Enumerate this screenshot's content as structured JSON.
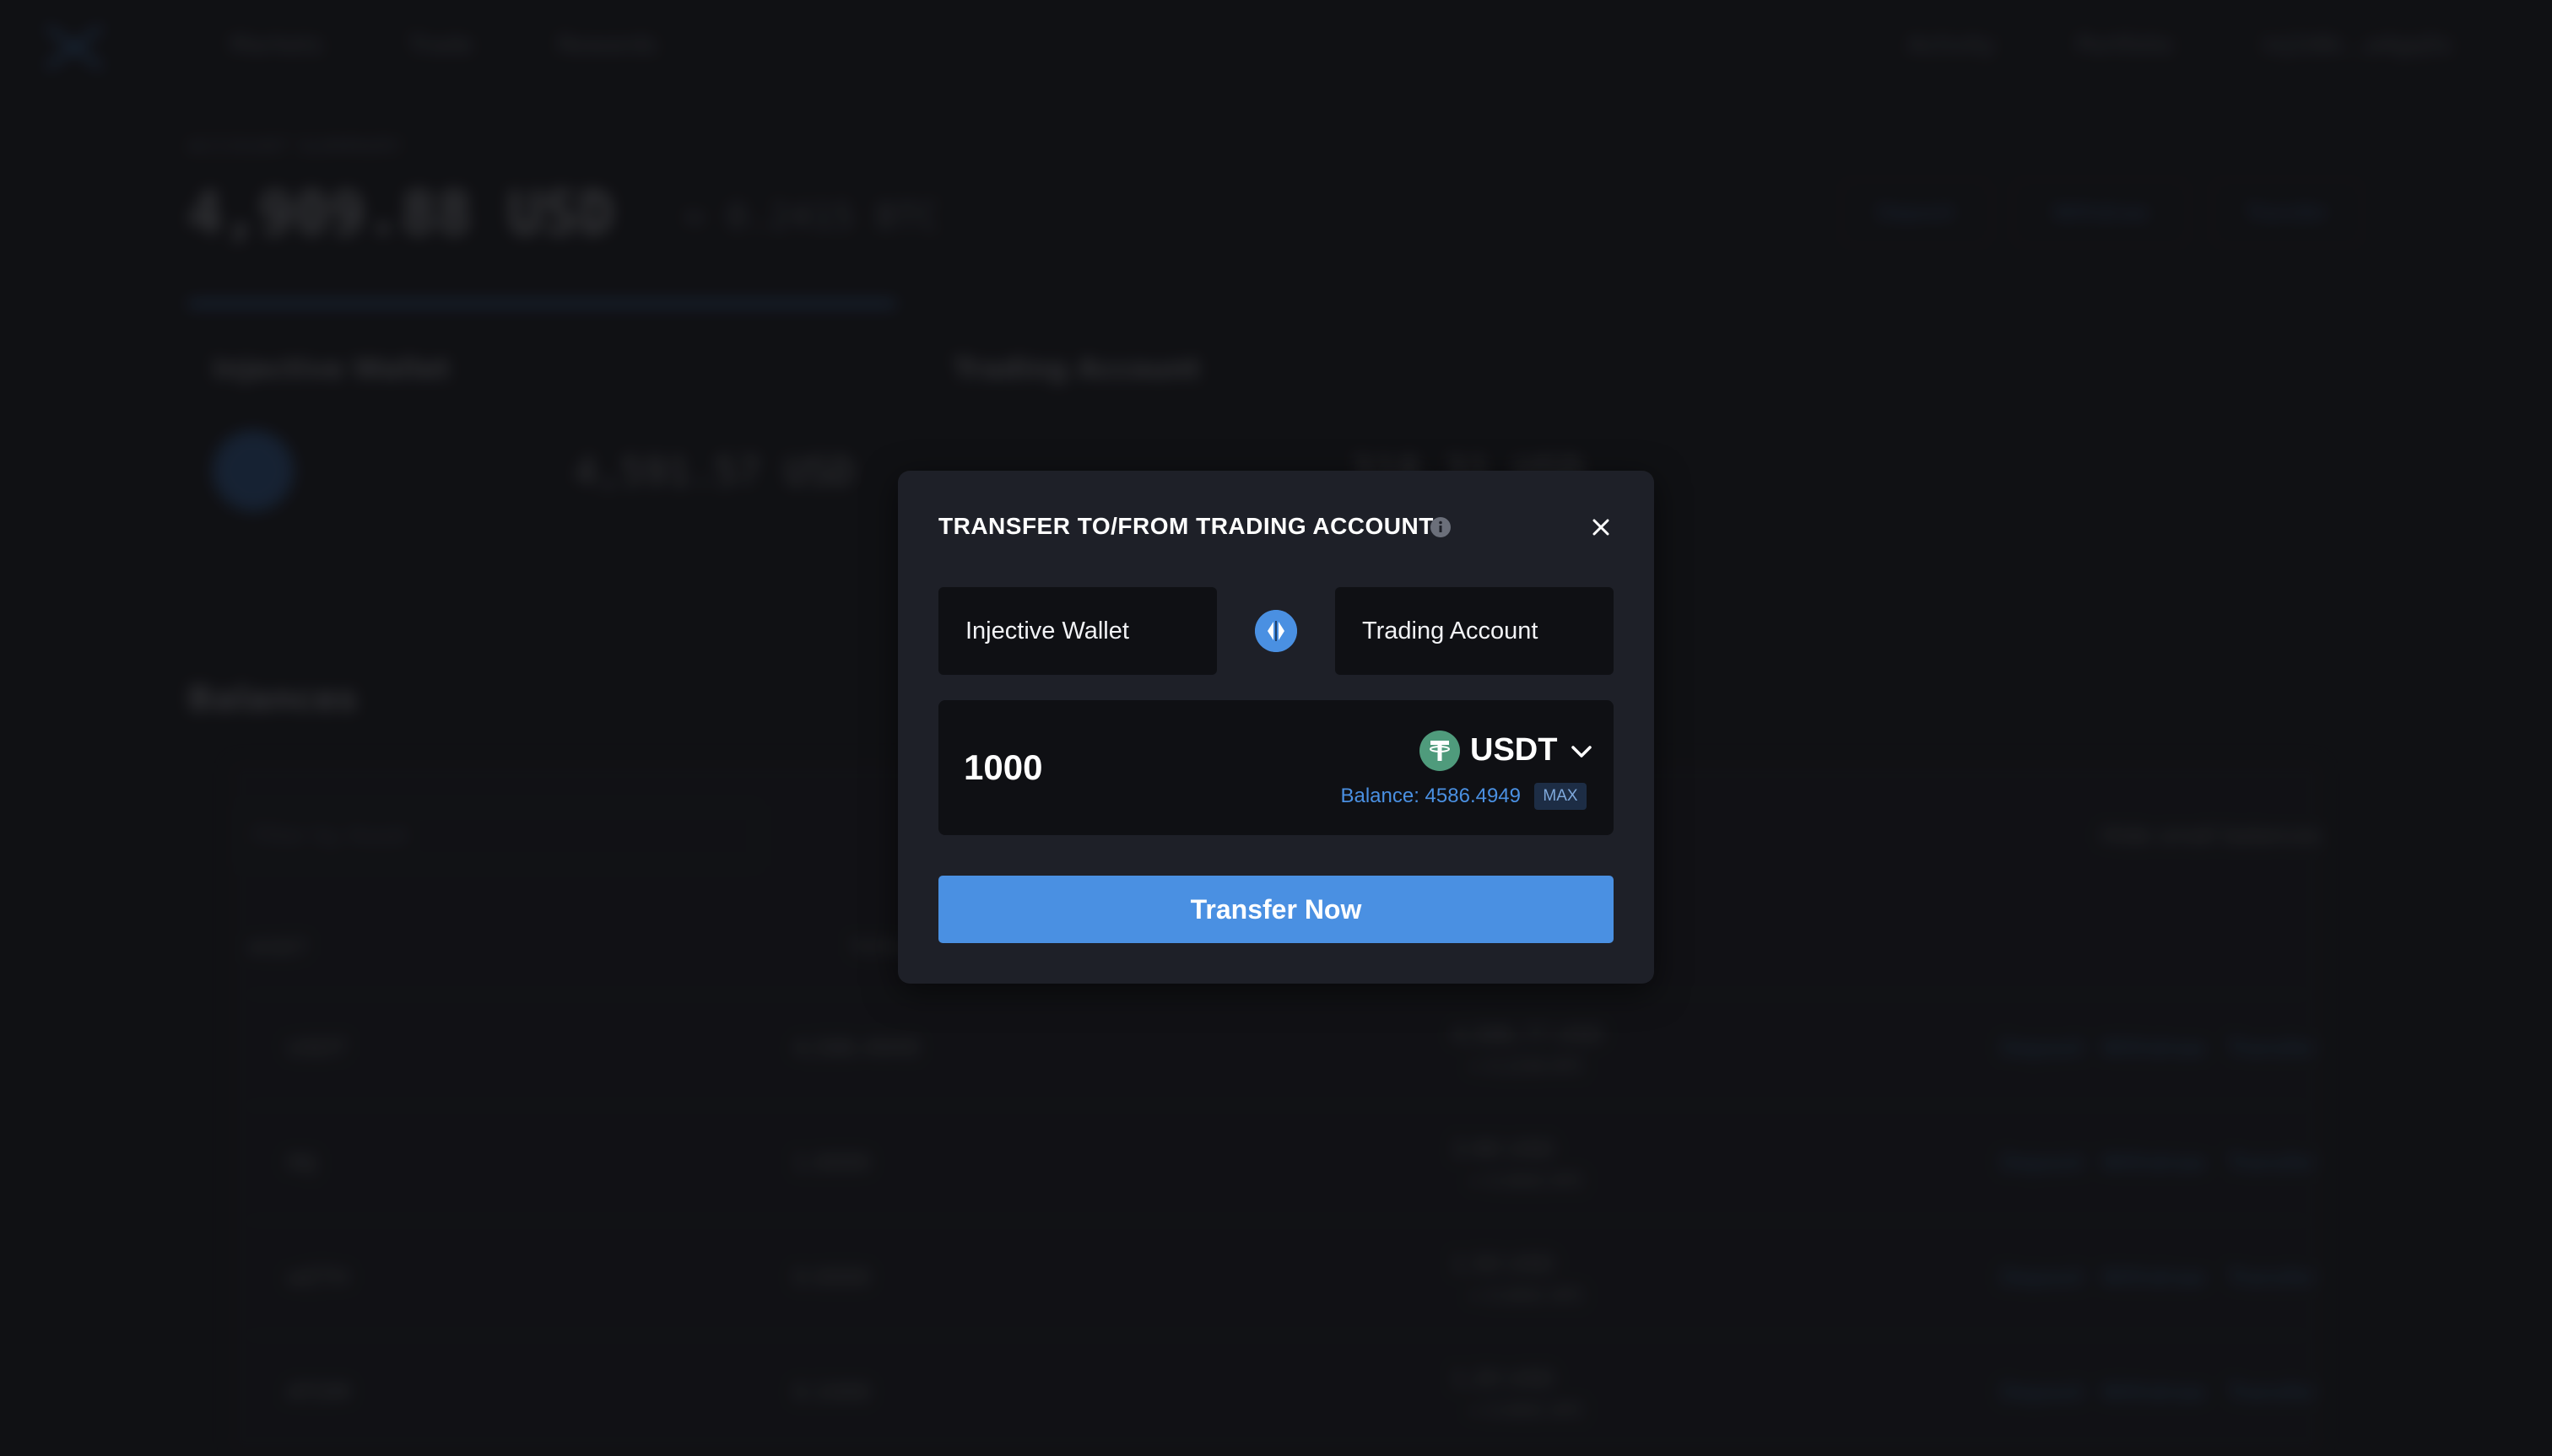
{
  "background": {
    "nav": [
      "Markets",
      "Trade",
      "Rewards"
    ],
    "nav_right": [
      "Activity",
      "Portfolio",
      "inj1t6k...a4gq5s"
    ],
    "account_label": "ACCOUNT SUMMARY",
    "account_value": "4,909.88 USD",
    "account_sub": "≈ 0.2415 BTC",
    "top_buttons": [
      "Deposit",
      "Withdraw",
      "Transfer"
    ],
    "wallet_card_title": "Injective Wallet",
    "wallet_card_value": "4,591.57 USD",
    "wallet_card_coin": "INJ",
    "trading_card_title": "Trading Account",
    "trading_card_value": "318.31 USD",
    "balances_title": "Balances",
    "filter_placeholder": "Filter by Asset",
    "hide_small": "Hide small balances",
    "table_header": [
      "ASSET",
      "TOTAL"
    ],
    "rows": [
      {
        "asset": "USDT",
        "total": "4,586.4949",
        "value": "4,586.77 USD",
        "sub": "≈ 0.2256 BTC"
      },
      {
        "asset": "INJ",
        "total": "1.0000",
        "value": "3.90 USD",
        "sub": "≈ 0.0002 BTC"
      },
      {
        "asset": "wETH",
        "total": "0.0000",
        "value": "1.50 USD",
        "sub": "≈ 0.0001 BTC"
      },
      {
        "asset": "ATOM",
        "total": "0.1000",
        "value": "1.20 USD",
        "sub": "≈ 0.0001 BTC"
      }
    ],
    "row_actions": [
      "Deposit",
      "Withdraw",
      "Transfer"
    ]
  },
  "modal": {
    "title": "TRANSFER TO/FROM TRADING ACCOUNT",
    "from": "Injective Wallet",
    "to": "Trading Account",
    "amount": "1000",
    "token": "USDT",
    "balance": "Balance: 4586.4949",
    "max_label": "MAX",
    "submit_label": "Transfer Now"
  },
  "icons": {
    "info": "info-icon",
    "close": "close-icon",
    "swap": "swap-arrows-icon",
    "token": "tether-icon",
    "chevron": "chevron-down-icon"
  },
  "colors": {
    "accent": "#4a90e2",
    "tether": "#4f9b7c",
    "modal_bg": "#1e2028",
    "field_bg": "#0f1014"
  }
}
